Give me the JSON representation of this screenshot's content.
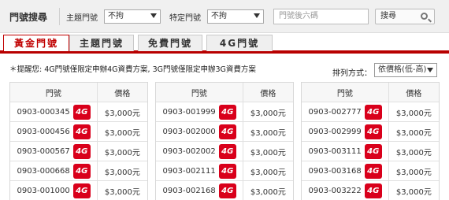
{
  "search": {
    "title": "門號搜尋",
    "theme_label": "主題門號",
    "theme_value": "不拘",
    "special_label": "特定門號",
    "special_value": "不拘",
    "input_placeholder": "門號後六碼",
    "button_label": "搜尋"
  },
  "tabs": [
    "黃金門號",
    "主題門號",
    "免費門號",
    "4G門號"
  ],
  "notice": "＊提醒您: 4G門號僅限定申辦4G資費方案, 3G門號僅限定申辦3G資費方案",
  "sort": {
    "label": "排列方式：",
    "value": "依價格(低-高)"
  },
  "table_headers": {
    "number": "門號",
    "price": "價格"
  },
  "badge_text": "4G",
  "columns": [
    [
      {
        "number": "0903-000345",
        "price": "$3,000元"
      },
      {
        "number": "0903-000456",
        "price": "$3,000元"
      },
      {
        "number": "0903-000567",
        "price": "$3,000元"
      },
      {
        "number": "0903-000668",
        "price": "$3,000元"
      },
      {
        "number": "0903-001000",
        "price": "$3,000元"
      }
    ],
    [
      {
        "number": "0903-001999",
        "price": "$3,000元"
      },
      {
        "number": "0903-002000",
        "price": "$3,000元"
      },
      {
        "number": "0903-002002",
        "price": "$3,000元"
      },
      {
        "number": "0903-002111",
        "price": "$3,000元"
      },
      {
        "number": "0903-002168",
        "price": "$3,000元"
      }
    ],
    [
      {
        "number": "0903-002777",
        "price": "$3,000元"
      },
      {
        "number": "0903-002999",
        "price": "$3,000元"
      },
      {
        "number": "0903-003111",
        "price": "$3,000元"
      },
      {
        "number": "0903-003168",
        "price": "$3,000元"
      },
      {
        "number": "0903-003222",
        "price": "$3,000元"
      }
    ]
  ],
  "colors": {
    "accent": "#c00000",
    "badge": "#d9001b"
  }
}
